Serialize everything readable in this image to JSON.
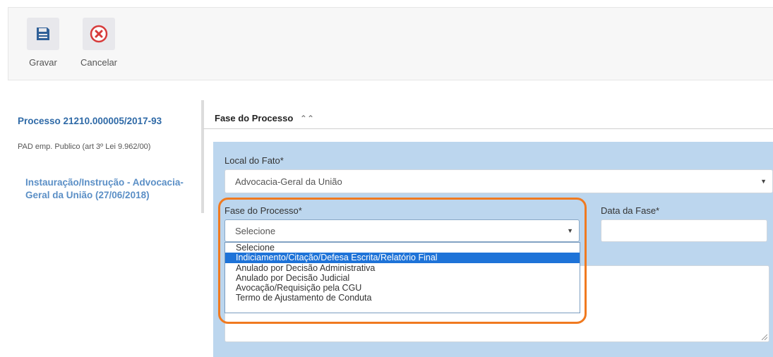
{
  "toolbar": {
    "save_label": "Gravar",
    "cancel_label": "Cancelar"
  },
  "sidebar": {
    "process_title": "Processo 21210.000005/2017-93",
    "process_subtitle": "PAD emp. Publico (art 3º Lei 9.962/00)",
    "phase_link": "Instauração/Instrução - Advocacia-Geral da União (27/06/2018)"
  },
  "section": {
    "title": "Fase do Processo",
    "toggle_glyph": "≈"
  },
  "form": {
    "local_label": "Local do Fato*",
    "local_value": "Advocacia-Geral da União",
    "fase_label": "Fase do Processo*",
    "fase_value": "Selecione",
    "data_label": "Data da Fase*",
    "data_value": "",
    "options": [
      "Selecione",
      "Indiciamento/Citação/Defesa Escrita/Relatório Final",
      "Anulado por Decisão Administrativa",
      "Anulado por Decisão Judicial",
      "Avocação/Requisição pela CGU",
      "Termo de Ajustamento de Conduta"
    ],
    "highlighted_option_index": 1
  },
  "colors": {
    "accent": "#2f6aa7",
    "panel": "#bcd6ee",
    "highlight": "#f07a20",
    "selected_option": "#1e73d8"
  },
  "icons": {
    "save": "floppy-disk-icon",
    "cancel": "close-circle-icon"
  }
}
